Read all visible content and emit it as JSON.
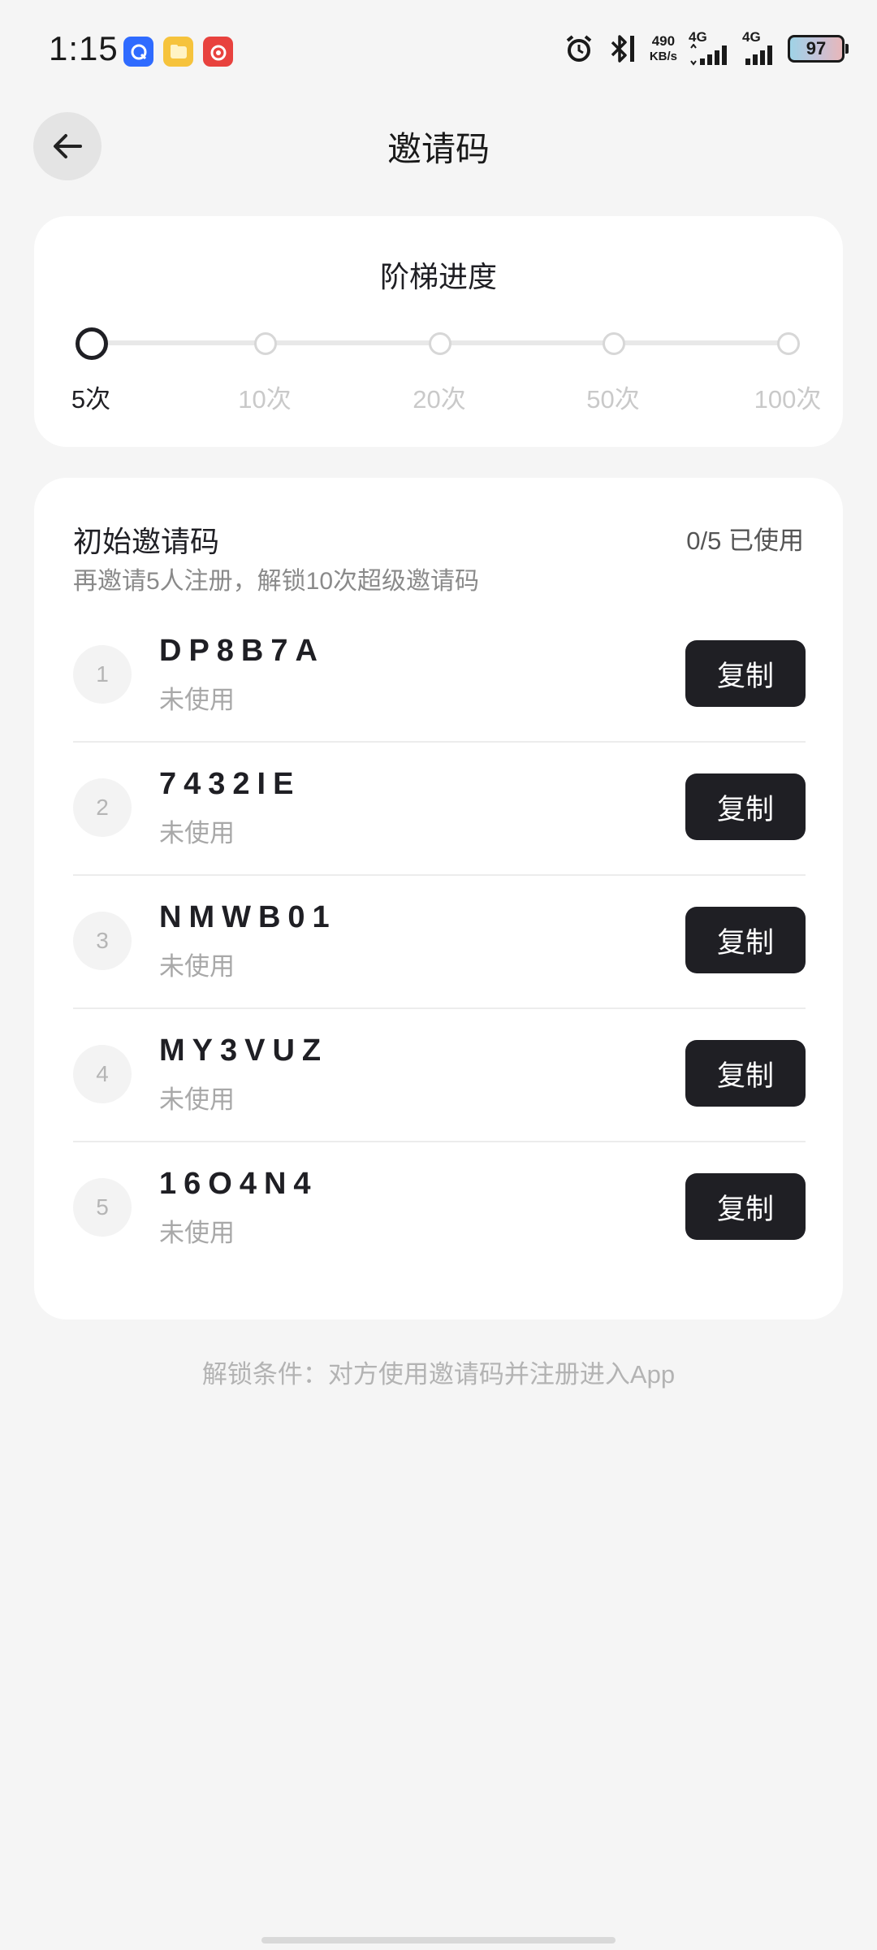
{
  "status_bar": {
    "time": "1:15",
    "net_speed_value": "490",
    "net_speed_unit": "KB/s",
    "signal_1_label": "4G",
    "signal_2_label": "4G",
    "battery": "97",
    "app_icons": [
      "browser-app-icon",
      "files-app-icon",
      "music-app-icon"
    ]
  },
  "header": {
    "title": "邀请码"
  },
  "progress": {
    "title": "阶梯进度",
    "current_index": 0,
    "steps": [
      "5次",
      "10次",
      "20次",
      "50次",
      "100次"
    ]
  },
  "codes": {
    "title": "初始邀请码",
    "usage": "0/5 已使用",
    "subtitle": "再邀请5人注册，解锁10次超级邀请码",
    "items": [
      {
        "index": "1",
        "code": "DP8B7A",
        "status": "未使用",
        "button": "复制"
      },
      {
        "index": "2",
        "code": "7432IE",
        "status": "未使用",
        "button": "复制"
      },
      {
        "index": "3",
        "code": "NMWB01",
        "status": "未使用",
        "button": "复制"
      },
      {
        "index": "4",
        "code": "MY3VUZ",
        "status": "未使用",
        "button": "复制"
      },
      {
        "index": "5",
        "code": "16O4N4",
        "status": "未使用",
        "button": "复制"
      }
    ]
  },
  "footer": {
    "note": "解锁条件：对方使用邀请码并注册进入App"
  },
  "colors": {
    "background": "#f5f5f5",
    "card": "#ffffff",
    "primary": "#1f1f24",
    "muted": "#a8a8a8"
  }
}
